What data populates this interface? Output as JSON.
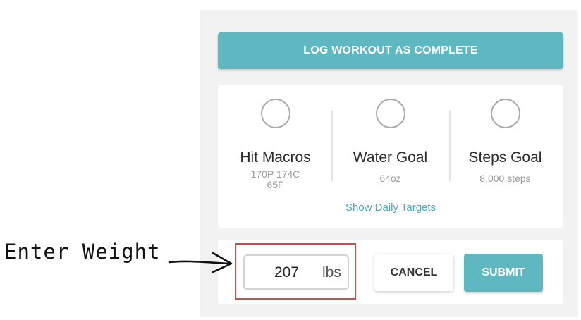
{
  "actions": {
    "log_workout_label": "LOG WORKOUT AS COMPLETE"
  },
  "goals": [
    {
      "title": "Hit Macros",
      "line1": "170P  174C",
      "line2": "65F"
    },
    {
      "title": "Water Goal",
      "detail": "64oz"
    },
    {
      "title": "Steps Goal",
      "detail": "8,000 steps"
    }
  ],
  "targets_link": "Show Daily Targets",
  "weight": {
    "value": "207",
    "unit": "lbs",
    "cancel_label": "CANCEL",
    "submit_label": "SUBMIT"
  },
  "annotation": {
    "text": "Enter Weight",
    "highlight_color": "#d24a4a"
  },
  "colors": {
    "accent": "#5fb8c1",
    "link": "#4aa9b4"
  }
}
